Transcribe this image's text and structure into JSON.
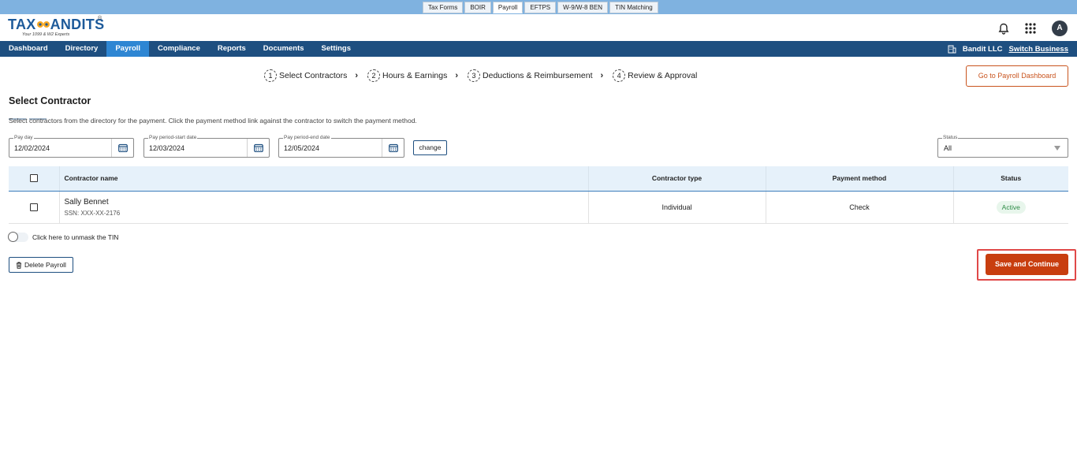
{
  "product_tabs": [
    "Tax Forms",
    "BOIR",
    "Payroll",
    "EFTPS",
    "W-9/W-8 BEN",
    "TIN Matching"
  ],
  "active_product_tab": "Payroll",
  "logo": {
    "word_left": "TAX",
    "word_right": "ANDITS",
    "tagline": "Your 1099 & W2 Experts",
    "reg": "R"
  },
  "header": {
    "avatar_initial": "A"
  },
  "nav": {
    "items": [
      "Dashboard",
      "Directory",
      "Payroll",
      "Compliance",
      "Reports",
      "Documents",
      "Settings"
    ],
    "active": "Payroll",
    "business_name": "Bandit LLC",
    "switch_label": "Switch Business"
  },
  "stepper": [
    {
      "num": "1",
      "label": "Select Contractors"
    },
    {
      "num": "2",
      "label": "Hours & Earnings"
    },
    {
      "num": "3",
      "label": "Deductions & Reimbursement"
    },
    {
      "num": "4",
      "label": "Review & Approval"
    }
  ],
  "go_dashboard_label": "Go to Payroll Dashboard",
  "page_title": "Select Contractor",
  "subtext": "Select contractors from the directory for the payment. Click the payment method link against the contractor to switch the payment method.",
  "fields": {
    "pay_day": {
      "label": "Pay day",
      "value": "12/02/2024"
    },
    "start": {
      "label": "Pay period-start date",
      "value": "12/03/2024"
    },
    "end": {
      "label": "Pay period-end date",
      "value": "12/05/2024"
    },
    "change_label": "change",
    "status": {
      "label": "Status",
      "value": "All"
    }
  },
  "table": {
    "headers": [
      "Contractor name",
      "Contractor type",
      "Payment method",
      "Status"
    ],
    "rows": [
      {
        "name": "Sally Bennet",
        "ssn": "SSN: XXX-XX-2176",
        "type": "Individual",
        "method": "Check",
        "status": "Active"
      }
    ]
  },
  "unmask_label": "Click here to unmask the TIN",
  "delete_label": "Delete Payroll",
  "save_label": "Save and Continue",
  "colors": {
    "nav_bg": "#1e4f80",
    "nav_active": "#2e86d3",
    "accent_orange": "#c83e0f",
    "highlight": "#e04848"
  }
}
